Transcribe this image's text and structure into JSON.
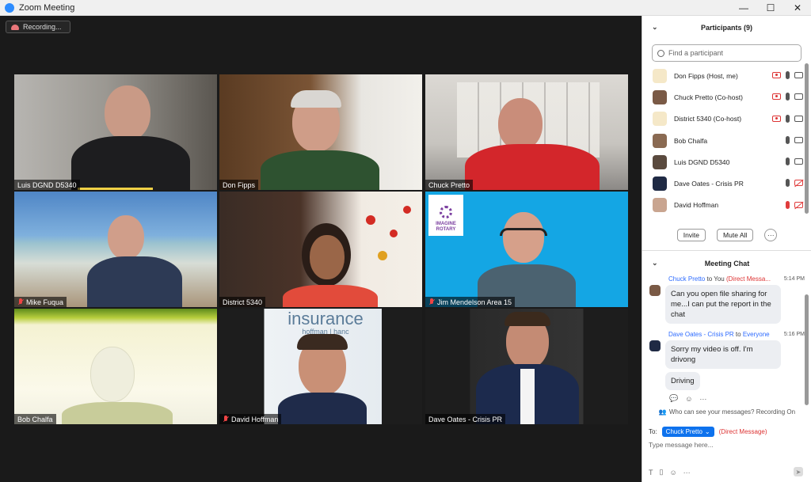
{
  "window": {
    "title": "Zoom Meeting",
    "controls": [
      "—",
      "☐",
      "✕"
    ]
  },
  "recording": {
    "label": "Recording..."
  },
  "tiles": [
    {
      "name": "Luis DGND D5340",
      "muted": false,
      "active": false,
      "bg": "#8d8a84"
    },
    {
      "name": "Don Fipps",
      "muted": false,
      "active": true,
      "bg": "#6b4a2e"
    },
    {
      "name": "Chuck Pretto",
      "muted": false,
      "active": false,
      "bg": "#c9c7c3"
    },
    {
      "name": "Mike Fuqua",
      "muted": true,
      "active": false,
      "bg": "#5f8fc4"
    },
    {
      "name": "District 5340",
      "muted": false,
      "active": false,
      "bg": "#3e2f28"
    },
    {
      "name": "Jim Mendelson Area 15",
      "muted": true,
      "active": false,
      "bg": "#14a6e4",
      "logo": "IMAGINE ROTARY"
    },
    {
      "name": "Bob Chalfa",
      "muted": false,
      "active": false,
      "bg": "#f3f1d6"
    },
    {
      "name": "David Hoffman",
      "muted": true,
      "active": false,
      "bg": "#e9eef2",
      "banner": "insurance",
      "banner2": "hoffman | hanc"
    },
    {
      "name": "Dave Oates - Crisis PR",
      "muted": false,
      "active": false,
      "bg": "#1e1e1e"
    }
  ],
  "participants": {
    "title": "Participants (9)",
    "search_placeholder": "Find a participant",
    "list": [
      {
        "name": "Don Fipps (Host, me)",
        "share": true,
        "mic": "on",
        "cam": "on"
      },
      {
        "name": "Chuck Pretto (Co-host)",
        "share": true,
        "mic": "on",
        "cam": "on"
      },
      {
        "name": "District 5340 (Co-host)",
        "share": true,
        "mic": "on",
        "cam": "on"
      },
      {
        "name": "Bob Chalfa",
        "share": false,
        "mic": "on",
        "cam": "on"
      },
      {
        "name": "Luis DGND D5340",
        "share": false,
        "mic": "on",
        "cam": "on"
      },
      {
        "name": "Dave Oates - Crisis PR",
        "share": false,
        "mic": "on",
        "cam": "off"
      },
      {
        "name": "David Hoffman",
        "share": false,
        "mic": "off",
        "cam": "off"
      }
    ],
    "buttons": {
      "invite": "Invite",
      "mute_all": "Mute All",
      "more": "···"
    }
  },
  "chat": {
    "title": "Meeting Chat",
    "messages": [
      {
        "from": "Chuck Pretto",
        "to_word": "to",
        "to": "You",
        "tag": "(Direct Messa...",
        "time": "5:14 PM",
        "text": "Can you open file sharing for me...I can put the report in the chat"
      },
      {
        "from": "Dave Oates - Crisis PR",
        "to_word": "to",
        "to": "Everyone",
        "time": "5:16 PM",
        "text": "Sorry my video is off. I'm drivong",
        "text2": "Driving"
      }
    ],
    "who_can_see": "Who can see your messages? Recording On",
    "to_label": "To:",
    "recipient": "Chuck Pretto",
    "recipient_tag": "(Direct Message)",
    "input_placeholder": "Type message here..."
  }
}
